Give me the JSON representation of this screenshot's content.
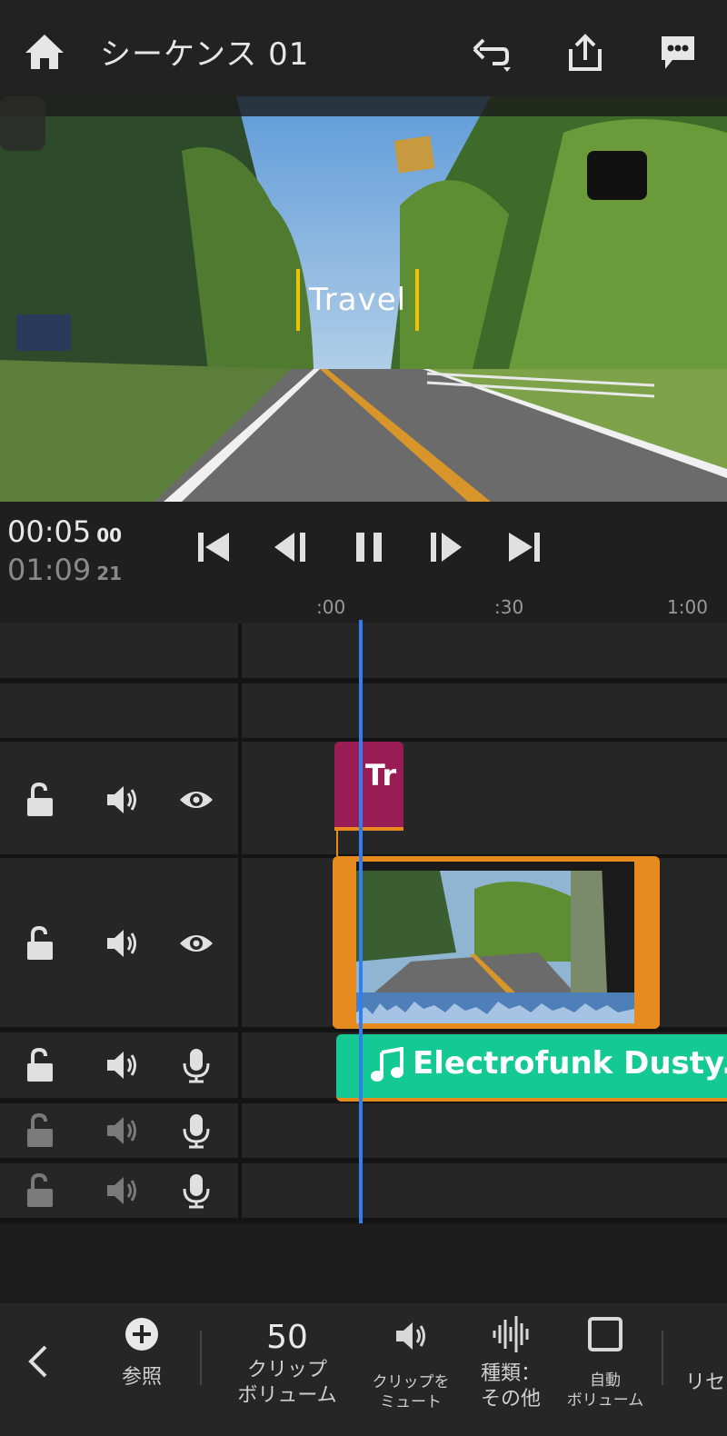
{
  "header": {
    "title": "シーケンス 01",
    "icons": [
      "home-icon",
      "undo-icon",
      "share-icon",
      "comment-icon"
    ]
  },
  "preview": {
    "overlay_text": "Travel",
    "overlay_bar_color": "#f2c200"
  },
  "transport": {
    "current_time": "00:05",
    "current_frames": "00",
    "total_time": "01:09",
    "total_frames": "21",
    "ruler": [
      ":00",
      ":30",
      "1:00"
    ]
  },
  "tracks": {
    "title_clip_label": "Tr",
    "audio_clip_label": "Electrofunk Dusty...",
    "colors": {
      "title_clip": "#9a1c55",
      "video_clip_border": "#e88b1e",
      "audio_clip": "#14c993",
      "playhead": "#2f7ff0"
    }
  },
  "toolbar": {
    "browse_label": "参照",
    "volume_value": "50",
    "clip_volume_line1": "クリップ",
    "clip_volume_line2": "ボリューム",
    "mute_line1": "クリップを",
    "mute_line2": "ミュート",
    "type_line1": "種類：",
    "type_line2": "その他",
    "auto_line1": "自動",
    "auto_line2": "ボリューム",
    "cut_off_label": "リセ"
  }
}
